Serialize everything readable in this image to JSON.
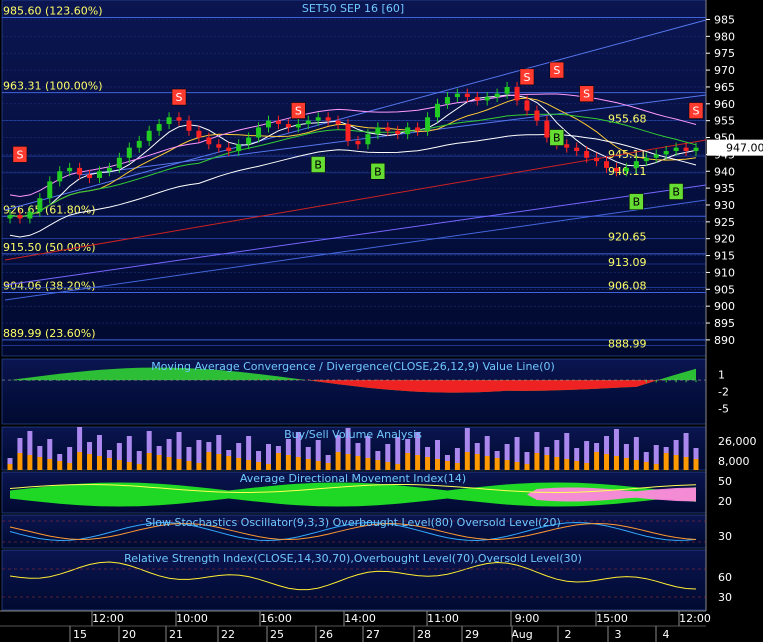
{
  "chart_data": [
    {
      "type": "candlestick",
      "title": "SET50 SEP 16  [60]",
      "y_ticks": [
        890,
        895,
        900,
        905,
        910,
        915,
        920,
        925,
        930,
        935,
        940,
        945,
        950,
        955,
        960,
        965,
        970,
        975,
        980,
        985
      ],
      "ylim": [
        887,
        989
      ],
      "last_price": "947.00",
      "fib_levels": [
        {
          "value": 985.6,
          "label": "985.60 (123.60%)"
        },
        {
          "value": 963.31,
          "label": "963.31 (100.00%)"
        },
        {
          "value": 926.65,
          "label": "926.65 (61.80%)"
        },
        {
          "value": 915.5,
          "label": "915.50 (50.00%)"
        },
        {
          "value": 904.06,
          "label": "904.06 (38.20%)"
        },
        {
          "value": 889.99,
          "label": "889.99 (23.60%)"
        }
      ],
      "level_labels": [
        {
          "value": 955.68,
          "label": "955.68"
        },
        {
          "value": 945.11,
          "label": "945.11"
        },
        {
          "value": 940.11,
          "label": "940.11"
        },
        {
          "value": 920.65,
          "label": "920.65"
        },
        {
          "value": 913.09,
          "label": "913.09"
        },
        {
          "value": 906.08,
          "label": "906.08"
        },
        {
          "value": 888.99,
          "label": "888.99"
        }
      ],
      "close_series": [
        927,
        926,
        928,
        932,
        937,
        940,
        941,
        939,
        938,
        940,
        941,
        944,
        947,
        949,
        952,
        954,
        956,
        955,
        952,
        950,
        948,
        947,
        946,
        948,
        950,
        953,
        955,
        954,
        953,
        954,
        955,
        956,
        955,
        954,
        949,
        948,
        951,
        953,
        952,
        951,
        953,
        952,
        956,
        960,
        962,
        963,
        962,
        961,
        962,
        963,
        965,
        961,
        958,
        955,
        950,
        948,
        947,
        946,
        944,
        943,
        941,
        940,
        941,
        943,
        944,
        945,
        946,
        947,
        946,
        947
      ],
      "signals": [
        {
          "type": "S",
          "bar": 1,
          "value": 945
        },
        {
          "type": "S",
          "bar": 17,
          "value": 962
        },
        {
          "type": "S",
          "bar": 29,
          "value": 958
        },
        {
          "type": "B",
          "bar": 31,
          "value": 942
        },
        {
          "type": "B",
          "bar": 37,
          "value": 940
        },
        {
          "type": "S",
          "bar": 52,
          "value": 968
        },
        {
          "type": "S",
          "bar": 55,
          "value": 970
        },
        {
          "type": "B",
          "bar": 55,
          "value": 950
        },
        {
          "type": "S",
          "bar": 58,
          "value": 963
        },
        {
          "type": "B",
          "bar": 63,
          "value": 931
        },
        {
          "type": "B",
          "bar": 67,
          "value": 934
        },
        {
          "type": "S",
          "bar": 69,
          "value": 958
        }
      ]
    },
    {
      "type": "area",
      "title": "Moving Average Convergence / Divergence(CLOSE,26,12,9) Value Line(0)",
      "y_ticks": [
        1,
        -2,
        -5
      ],
      "ylim": [
        -7,
        3
      ]
    },
    {
      "type": "bar",
      "title": "Buy/Sell Volume Analysis",
      "y_ticks": [
        "26,000",
        "8,000"
      ]
    },
    {
      "type": "area",
      "title": "Average Directional Movement Index(14)",
      "y_ticks": [
        50,
        20
      ]
    },
    {
      "type": "line",
      "title": "Slow Stochastics Oscillator(9,3,3) Overbought Level(80) Oversold Level(20)",
      "y_ticks": [
        30
      ]
    },
    {
      "type": "line",
      "title": "Relative Strength Index(CLOSE,14,30,70),Overbought Level(70),Oversold Level(30)",
      "y_ticks": [
        60,
        30
      ]
    }
  ],
  "x_axis": {
    "time_labels": [
      "12:00",
      "10:00",
      "16:00",
      "14:00",
      "11:00",
      "9:00",
      "15:00",
      "12:00"
    ],
    "date_labels": [
      "15",
      "20",
      "21",
      "22",
      "25",
      "26",
      "27",
      "28",
      "29",
      "Aug",
      "2",
      "3",
      "4"
    ]
  },
  "colors": {
    "background_top": "#0b1550",
    "background_bottom": "#000a30",
    "bull": "#22cc22",
    "bear": "#ff2222",
    "axis_text": "#ffffff",
    "title_text": "#6fc8ff",
    "fib_text": "#ffff66",
    "sell_badge": "#ff3b30",
    "buy_badge": "#66dd33",
    "price_tag": "#ffffff"
  }
}
